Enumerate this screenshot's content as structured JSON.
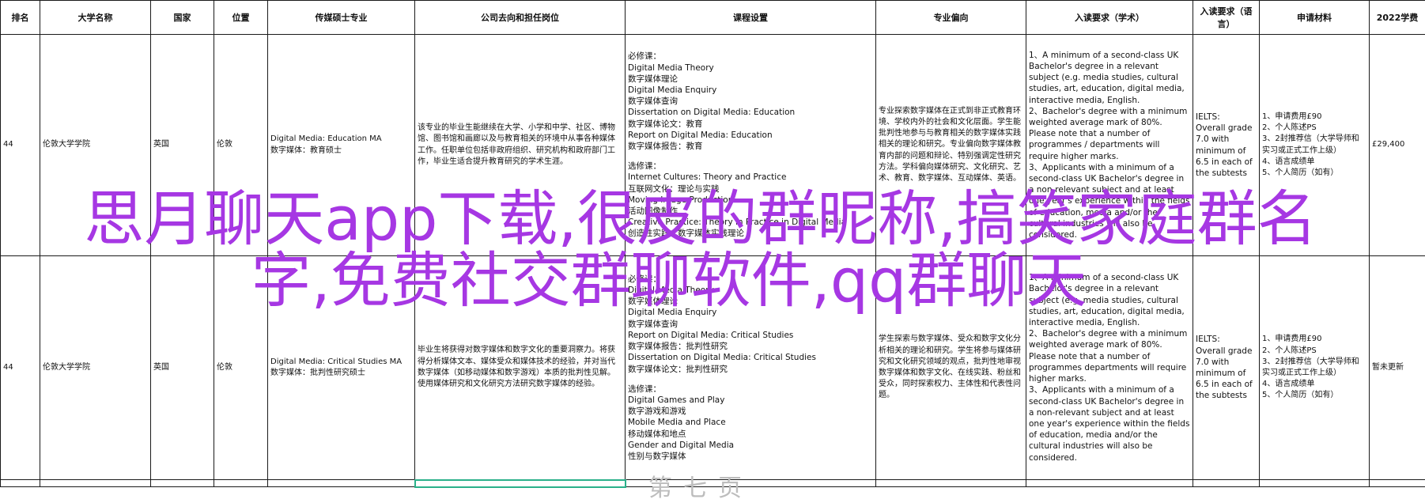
{
  "columns": [
    "排名",
    "大学名称",
    "国家",
    "位置",
    "传媒硕士专业",
    "公司去向和担任岗位",
    "课程设置",
    "专业偏向",
    "入读要求（学术）",
    "入读要求（语言）",
    "申请材料",
    "2022学费"
  ],
  "rows": [
    {
      "rank": "44",
      "university": "伦敦大学学院",
      "country": "英国",
      "location": "伦敦",
      "program": [
        "Digital Media: Education MA",
        "数字媒体：教育硕士"
      ],
      "careers": "该专业的毕业生能继续在大学、小学和中学、社区、博物馆、图书馆和画廊以及与教育相关的环境中从事各种媒体工作。任职单位包括非政府组织、研究机构和政府部门工作，毕业生适合提升教育研究的学术生涯。",
      "courses": [
        "必修课：",
        "Digital Media Theory",
        "数字媒体理论",
        "Digital Media Enquiry",
        "数字媒体查询",
        "Dissertation on Digital Media: Education",
        "数字媒体论文：教育",
        "Report on Digital Media: Education",
        "数字媒体报告：教育",
        "",
        "选修课：",
        "Internet Cultures: Theory and Practice",
        "互联网文化：理论与实践",
        "Moving Image Production",
        "活动图像制作",
        "Creative Practice: Theory in Practice in Digital Media",
        "创造性实践：数字媒体实践理论"
      ],
      "focus": "专业探索数字媒体在正式到非正式教育环境、学校内外的社会和文化层面。学生能批判性地参与与教育相关的数字媒体实践相关的理论和研究。专业偏向数字媒体教育内部的问题和辩论、特别强调定性研究方法。学科偏向媒体研究、文化研究、艺术、教育、数字媒体、互动媒体、英语。",
      "academic": [
        "1、A minimum of a second-class UK Bachelor's degree in a relevant subject (e.g. media studies, cultural studies, art, education, digital media, interactive media, English.",
        "2、Bachelor's degree with a minimum weighted average mark of 80%. Please note that a number of programmes / departments will require higher marks.",
        "3、Applicants with a minimum of a second-class UK Bachelor's degree in a non-relevant subject and at least one year's experience within the fields of education, media and/or the cultural industries will also be considered."
      ],
      "language": [
        "IELTS:",
        "Overall grade 7.0 with minimum of 6.5 in each of the subtests"
      ],
      "materials": [
        "1、申请费用£90",
        "2、个人陈述PS",
        "3、2封推荐信（大学导师和实习或正式工作上级）",
        "4、语言成绩单",
        "5、个人简历（如有）"
      ],
      "tuition": "£29,400"
    },
    {
      "rank": "44",
      "university": "伦敦大学学院",
      "country": "英国",
      "location": "伦敦",
      "program": [
        "Digital Media: Critical Studies MA",
        "数字媒体：批判性研究硕士"
      ],
      "careers": "毕业生将获得对数字媒体和数字文化的重要洞察力。将获得分析媒体文本、媒体受众和媒体技术的经验，并对当代数字媒体（如移动媒体和数字游戏）本质的批判性见解。使用媒体研究和文化研究方法研究数字媒体的经验。",
      "courses": [
        "必修课：",
        "Digital Media Theory",
        "数字媒体理论",
        "Digital Media Enquiry",
        "数字媒体查询",
        "Report on Digital Media: Critical Studies",
        "数字媒体报告：批判性研究",
        "Dissertation on Digital Media: Critical Studies",
        "数字媒体论文：批判性研究",
        "",
        "选修课：",
        "Digital Games and Play",
        "数字游戏和游戏",
        "Mobile Media and Place",
        "移动媒体和地点",
        "Gender and Digital Media",
        "性别与数字媒体"
      ],
      "focus": "学生探索与数字媒体、受众和数字文化分析相关的理论和研究。学生将参与媒体研究和文化研究领域的观点，批判性地审视数字媒体和数字文化、在线实践、粉丝和受众，同时探索权力、主体性和代表性问题。",
      "academic": [
        "1、A minimum of a second-class UK Bachelor's degree in a relevant subject (e.g. media studies, cultural studies, art, education, digital media, interactive media, English.",
        "2、Bachelor's degree with a minimum weighted average mark of 80%. Please note that a number of programmes departments will require higher marks.",
        "3、Applicants with a minimum of a second-class UK Bachelor's degree in a non-relevant subject and at least one year's experience within the fields of education, media and/or the cultural industries will also be considered."
      ],
      "language": [
        "IELTS:",
        "Overall grade 7.0 with minimum of 6.5 in each of the subtests"
      ],
      "materials": [
        "1、申请费用£90",
        "2、个人陈述PS",
        "3、2封推荐信（大学导师和实习或正式工作上级）",
        "4、语言成绩单",
        "5、个人简历（如有）"
      ],
      "tuition": "暂未更新"
    }
  ],
  "watermark": {
    "line1": "思月聊天app下载,很皮的群昵称,搞笑家庭群名",
    "line2": "字,免费社交群聊软件,qq群聊天"
  },
  "footer_ghost": "第七页",
  "colors": {
    "watermark": "#a637e3",
    "highlight_border": "#2bb08a",
    "grid": "#1a1a1a"
  }
}
